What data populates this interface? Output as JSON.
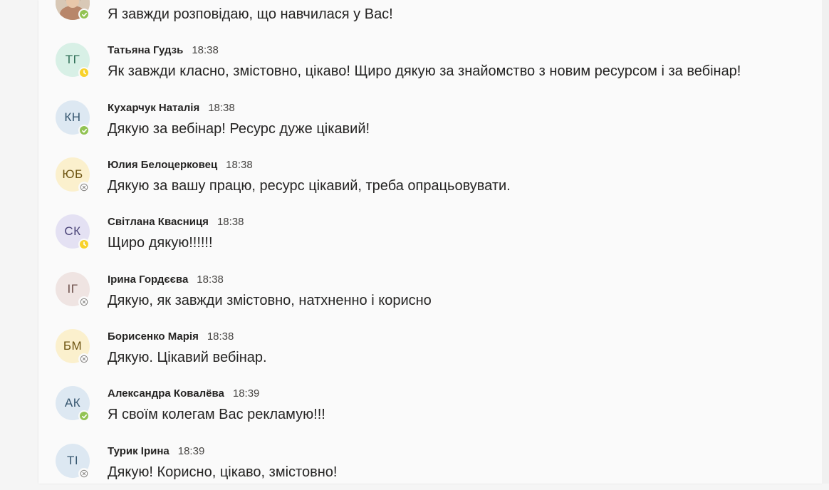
{
  "colors": {
    "available": "#92c353",
    "away": "#f8d22a",
    "offline": "#8a8886"
  },
  "messages": [
    {
      "initials": "",
      "avatar": "photo",
      "presence": "available",
      "sender": "",
      "time": "",
      "text": "Я завжди розповідаю, що навчилася у Вас!"
    },
    {
      "initials": "ТГ",
      "avatar": "mint",
      "presence": "away",
      "sender": "Татьяна Гудзь",
      "time": "18:38",
      "text": "Як завжди класно, змістовно, цікаво! Щиро дякую за знайомство з новим ресурсом  і за вебінар!"
    },
    {
      "initials": "КН",
      "avatar": "blue",
      "presence": "available",
      "sender": "Кухарчук Наталія",
      "time": "18:38",
      "text": "Дякую за вебінар! Ресурс дуже цікавий!"
    },
    {
      "initials": "ЮБ",
      "avatar": "yellow",
      "presence": "offline",
      "sender": "Юлия Белоцерковец",
      "time": "18:38",
      "text": "Дякую за вашу працю, ресурс цікавий, треба опрацьовувати."
    },
    {
      "initials": "СК",
      "avatar": "lavender",
      "presence": "away",
      "sender": "Світлана Квасниця",
      "time": "18:38",
      "text": "Щиро дякую!!!!!!"
    },
    {
      "initials": "ІГ",
      "avatar": "rose",
      "presence": "offline",
      "sender": "Ірина Гордєєва",
      "time": "18:38",
      "text": "Дякую, як завжди змістовно, натхненно і корисно"
    },
    {
      "initials": "БМ",
      "avatar": "yellow",
      "presence": "offline",
      "sender": "Борисенко Марія",
      "time": "18:38",
      "text": "Дякую. Цікавий вебінар."
    },
    {
      "initials": "АК",
      "avatar": "blue",
      "presence": "available",
      "sender": "Александра Ковалёва",
      "time": "18:39",
      "text": "Я своїм колегам Вас рекламую!!!"
    },
    {
      "initials": "ТІ",
      "avatar": "blue",
      "presence": "offline",
      "sender": "Турик Ірина",
      "time": "18:39",
      "text": "Дякую! Корисно, цікаво, змістовно!"
    }
  ],
  "avatar_palettes": {
    "mint": {
      "bg": "#d8f0e6",
      "fg": "#2f6f57"
    },
    "blue": {
      "bg": "#dde8f2",
      "fg": "#36566f"
    },
    "yellow": {
      "bg": "#fbf0cd",
      "fg": "#6d5411"
    },
    "lavender": {
      "bg": "#e4e1f3",
      "fg": "#4a4378"
    },
    "rose": {
      "bg": "#efe4e2",
      "fg": "#6c4e49"
    }
  }
}
